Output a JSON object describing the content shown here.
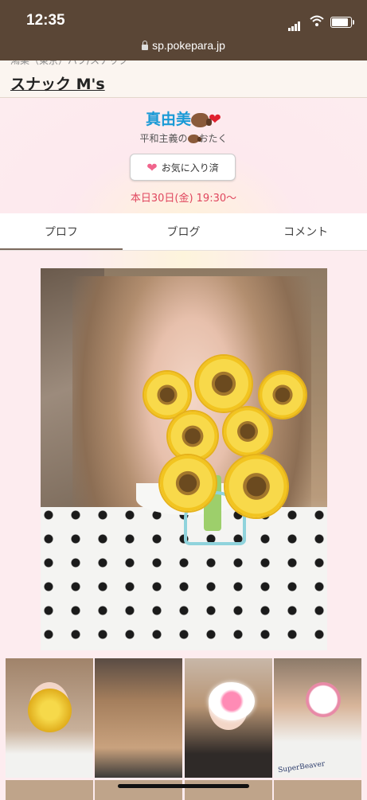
{
  "status_bar": {
    "time": "12:35",
    "url": "sp.pokepara.jp"
  },
  "shop": {
    "area": "鴻巣（東京）パブ/スナック",
    "name": "スナック M's"
  },
  "profile": {
    "name": "真由美",
    "catchphrase_pre": "平和主義の",
    "catchphrase_post": "おたく",
    "favorite_label": "お気に入り済",
    "schedule": "本日30日(金) 19:30〜"
  },
  "tabs": [
    {
      "label": "プロフ",
      "active": true
    },
    {
      "label": "ブログ",
      "active": false
    },
    {
      "label": "コメント",
      "active": false
    }
  ],
  "thumbs": [
    {
      "overlay": "sunflower-bouquet"
    },
    {
      "overlay": "none"
    },
    {
      "overlay": "pink-cloud"
    },
    {
      "overlay": "dog-face",
      "caption": "SuperBeaver"
    }
  ],
  "colors": {
    "status_bg": "#5a4636",
    "name": "#1a9ad6",
    "schedule": "#e0465e",
    "heart": "#f0648c",
    "tab_indicator": "#7b6a5d"
  }
}
